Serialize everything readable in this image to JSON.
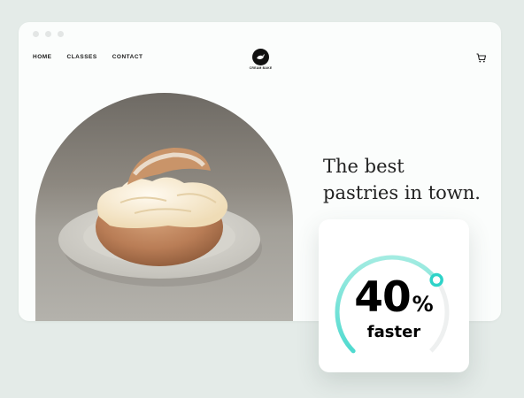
{
  "nav": {
    "items": [
      {
        "label": "HOME"
      },
      {
        "label": "CLASSES"
      },
      {
        "label": "CONTACT"
      }
    ]
  },
  "logo": {
    "text": "CREAM BAKE"
  },
  "hero": {
    "image": "cream-bun-pastry-on-plate",
    "headline_line1": "The best",
    "headline_line2": "pastries in town."
  },
  "stat": {
    "value": "40",
    "unit": "%",
    "label": "faster",
    "progress_fraction": 0.7
  },
  "colors": {
    "background": "#e4ebe8",
    "accent": "#2ed3c8",
    "text": "#222222"
  },
  "icons": {
    "cart": "cart-icon",
    "logo": "bird-logo-icon"
  }
}
